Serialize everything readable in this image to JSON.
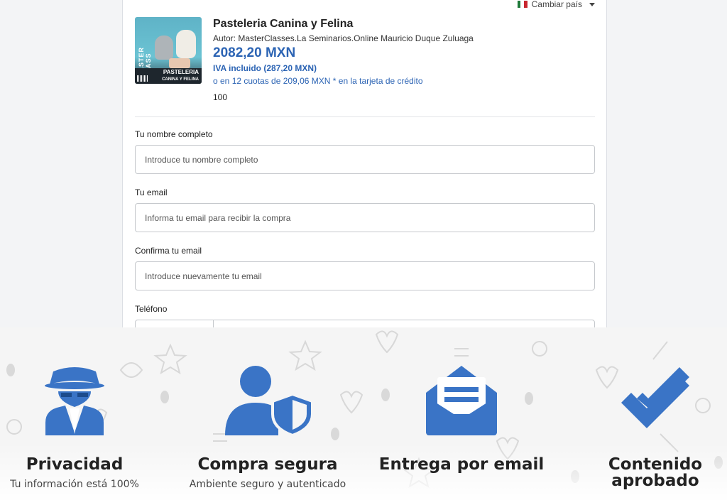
{
  "header": {
    "change_country": "Cambiar país"
  },
  "product": {
    "cover_vertical_text": "MASTER CLASS",
    "cover_title_line1": "PASTELERIA",
    "cover_title_line2": "CANINA Y FELINA",
    "title": "Pasteleria Canina y Felina",
    "author": "Autor: MasterClasses.La Seminarios.Online Mauricio Duque Zuluaga",
    "price": "2082,20 MXN",
    "tax": "IVA incluido (287,20 MXN)",
    "installments": "o en 12 cuotas de 209,06 MXN * en la tarjeta de crédito",
    "quantity": "100"
  },
  "form": {
    "name_label": "Tu nombre completo",
    "name_placeholder": "Introduce tu nombre completo",
    "email_label": "Tu email",
    "email_placeholder": "Informa tu email para recibir la compra",
    "confirm_label": "Confirma tu email",
    "confirm_placeholder": "Introduce nuevamente tu email",
    "phone_label": "Teléfono"
  },
  "features": [
    {
      "title": "Privacidad",
      "desc": "Tu información está 100%",
      "icon": "spy-icon"
    },
    {
      "title": "Compra segura",
      "desc": "Ambiente seguro y autenticado",
      "icon": "user-shield-icon"
    },
    {
      "title": "Entrega por email",
      "desc": "",
      "icon": "envelope-open-icon"
    },
    {
      "title": "Contenido aprobado",
      "desc": "",
      "icon": "double-check-icon"
    }
  ],
  "colors": {
    "accent": "#2c64b4",
    "icon_blue": "#3a74c6",
    "flag_green": "#1f7a3a",
    "flag_red": "#c8262e"
  }
}
